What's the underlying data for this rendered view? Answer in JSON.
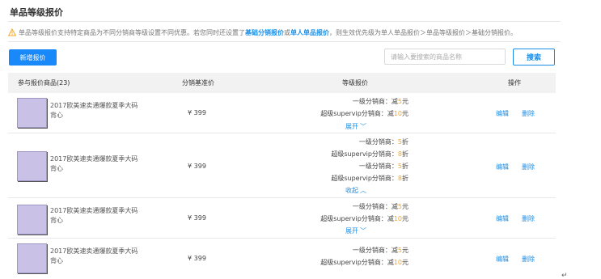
{
  "page": {
    "title": "单品等级报价"
  },
  "notice": {
    "part1": "单品等级报价支持特定商品为不同分销商等级设置不同优惠。若您同时还设置了",
    "link1": "基础分销报价",
    "part2": "或",
    "link2": "单人单品报价",
    "part3": "，则生效优先级为单人单品报价＞单品等级报价＞基础分销报价。"
  },
  "toolbar": {
    "new_label": "新增报价",
    "search_placeholder": "请输入要搜索的商品名称",
    "search_label": "搜索"
  },
  "table": {
    "headers": {
      "product": "参与报价商品(23)",
      "base_price": "分销基准价",
      "tier_price": "等级报价",
      "actions": "操作"
    },
    "rows": [
      {
        "name": "2017欧美速卖通爆款夏季大码背心",
        "price": "¥ 399",
        "tiers": [
          {
            "label": "一级分销商：",
            "prefix": "减",
            "value": "5",
            "suffix": "元"
          },
          {
            "label": "超级supervip分销商：",
            "prefix": "减",
            "value": "10",
            "suffix": "元"
          }
        ],
        "toggle": "展开",
        "edit": "编辑",
        "delete": "删除"
      },
      {
        "name": "2017欧美速卖通爆款夏季大码背心",
        "price": "¥ 399",
        "tiers": [
          {
            "label": "一级分销商：",
            "prefix": "",
            "value": "5",
            "suffix": "折"
          },
          {
            "label": "超级supervip分销商：",
            "prefix": "",
            "value": "8",
            "suffix": "折"
          },
          {
            "label": "一级分销商：",
            "prefix": "",
            "value": "5",
            "suffix": "折"
          },
          {
            "label": "超级supervip分销商：",
            "prefix": "",
            "value": "8",
            "suffix": "折"
          }
        ],
        "toggle": "收起",
        "edit": "编辑",
        "delete": "删除"
      },
      {
        "name": "2017欧美速卖通爆款夏季大码背心",
        "price": "¥ 399",
        "tiers": [
          {
            "label": "一级分销商：",
            "prefix": "减",
            "value": "5",
            "suffix": "元"
          },
          {
            "label": "超级supervip分销商：",
            "prefix": "减",
            "value": "10",
            "suffix": "元"
          }
        ],
        "toggle": "展开",
        "edit": "编辑",
        "delete": "删除"
      },
      {
        "name": "2017欧美速卖通爆款夏季大码背心",
        "price": "¥ 399",
        "tiers": [
          {
            "label": "一级分销商：",
            "prefix": "减",
            "value": "5",
            "suffix": "元"
          },
          {
            "label": "超级supervip分销商：",
            "prefix": "减",
            "value": "10",
            "suffix": "元"
          }
        ],
        "toggle": "",
        "edit": "编辑",
        "delete": "删除"
      }
    ]
  },
  "trailing_mark": "↵",
  "colors": {
    "accent": "#1989fa",
    "link": "#1a8ee6",
    "highlight": "#f5a623",
    "header_bg": "#f2f2f2"
  }
}
